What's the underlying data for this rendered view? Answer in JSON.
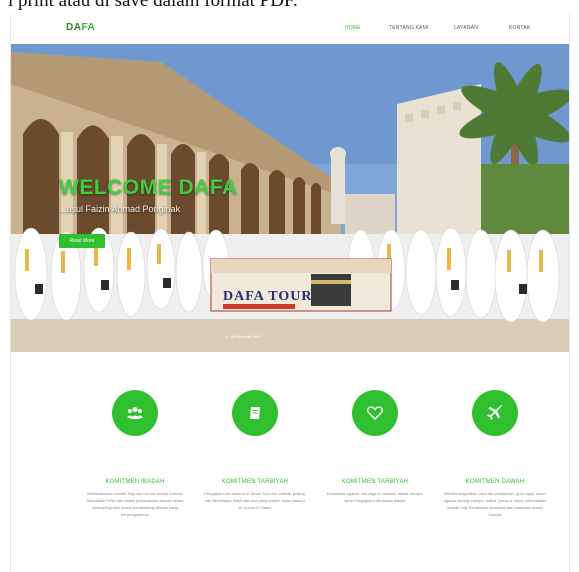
{
  "caption": "l print atau di save dalam format PDF.",
  "navbar": {
    "logo_prefix": "DA",
    "logo_suffix": "FA",
    "items": [
      {
        "label": "HOME",
        "active": true
      },
      {
        "label": "TENTANG KAMI",
        "active": false
      },
      {
        "label": "LAYANAN",
        "active": false
      },
      {
        "label": "KONTAK",
        "active": false
      }
    ]
  },
  "hero": {
    "title": "WELCOME DAFA",
    "subtitle": "...asul Faizin Ahmad Ponginak",
    "button": "Read More",
    "banner_title": "DAFA TOUR",
    "banner_date": "8 - 16 Februari 2019"
  },
  "features": [
    {
      "icon": "users-icon",
      "title": "KOMITMEN IBADAH",
      "description": "Melaksanakan Ibadah Haji dan Umrah sesuai Sunnah Rasulullah SAW dan dalam pelaksanaan ibadah selalu didampingi oleh sosok pembimbing ibadah yang berpengalaman"
    },
    {
      "icon": "book-icon",
      "title": "KOMITMEN TARBIYAH",
      "description": "Pengajian rutin selama di Tanah Suci dan setelah pulang. dan Bimbingan dzikir dan doa yang shahih serta tadabur Al Qur'an & Hadits"
    },
    {
      "icon": "heart-icon",
      "title": "KOMITMEN TARBIYAH",
      "description": "Konsultasi Agama, keluarga & masalah aktual lainnya, serta Pengajian rutin pasca ibadah"
    },
    {
      "icon": "plane-icon",
      "title": "KOMITMEN DAWAH",
      "description": "Memberangkatkan para dai pedalaman, guru ngaji, tokoh agama kurang mampu, hafidz Quran & untuk menunaikan ibadah Haji Pemberian beasiswa dan santunan sosial lainnya"
    }
  ],
  "colors": {
    "accent": "#2fbf2f",
    "logo": "#2e7d32"
  }
}
